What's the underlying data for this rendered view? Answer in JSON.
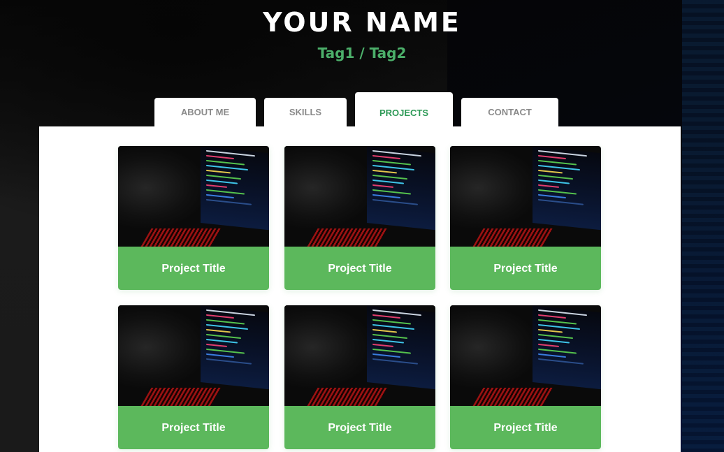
{
  "header": {
    "name": "YOUR NAME",
    "tags": "Tag1 / Tag2"
  },
  "colors": {
    "accent_green": "#5cb85c",
    "tag_green": "#4caf6a",
    "active_tab": "#2e9a57",
    "inactive_tab": "#8a8a8a"
  },
  "tabs": [
    {
      "label": "ABOUT ME",
      "active": false
    },
    {
      "label": "SKILLS",
      "active": false
    },
    {
      "label": "PROJECTS",
      "active": true
    },
    {
      "label": "CONTACT",
      "active": false
    }
  ],
  "projects": [
    {
      "title": "Project Title",
      "image": "laptop-code-image"
    },
    {
      "title": "Project Title",
      "image": "laptop-code-image"
    },
    {
      "title": "Project Title",
      "image": "laptop-code-image"
    },
    {
      "title": "Project Title",
      "image": "laptop-code-image"
    },
    {
      "title": "Project Title",
      "image": "laptop-code-image"
    },
    {
      "title": "Project Title",
      "image": "laptop-code-image"
    }
  ]
}
